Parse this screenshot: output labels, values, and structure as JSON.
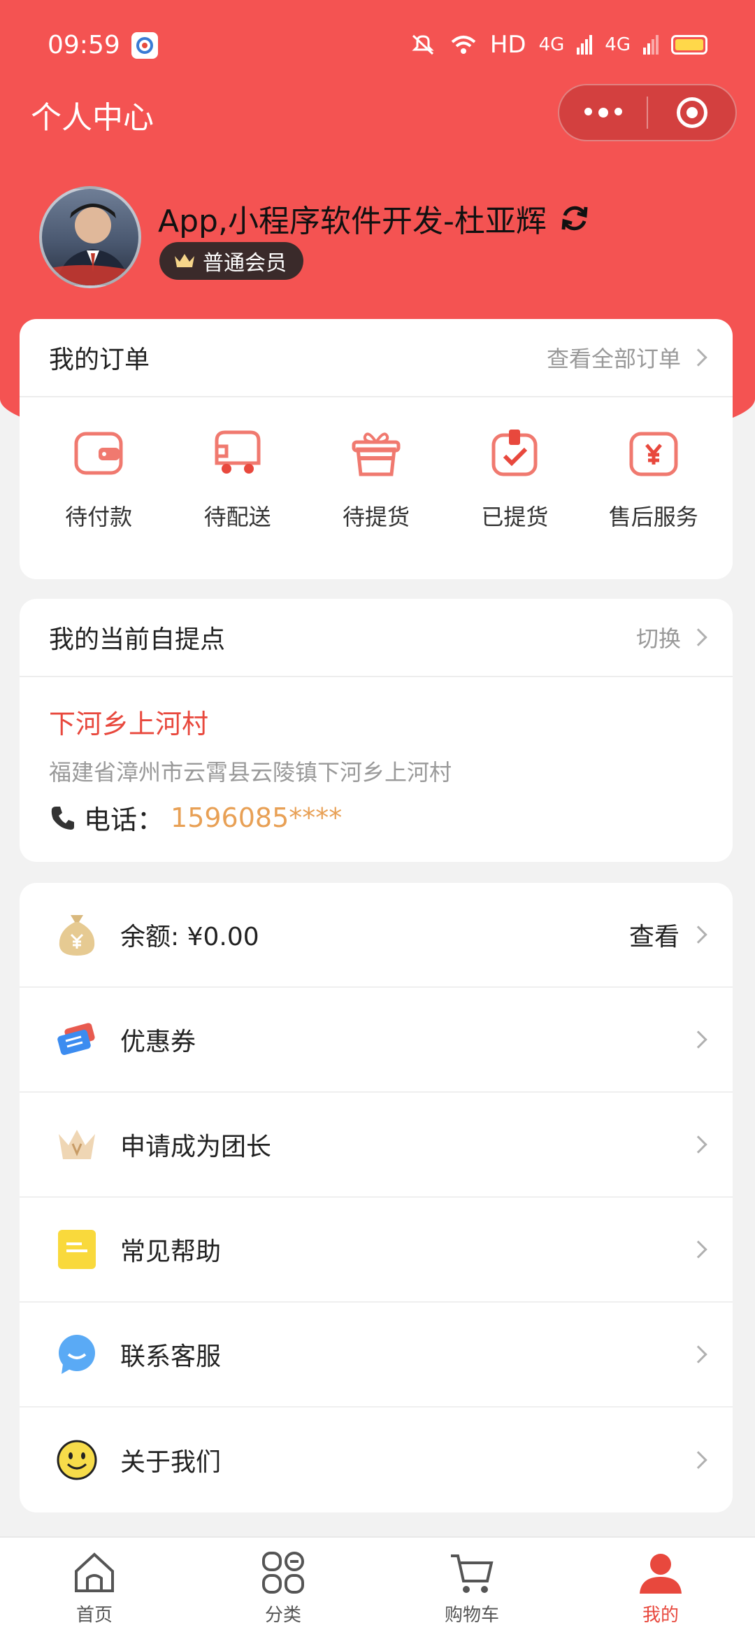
{
  "status_bar": {
    "time": "09:59",
    "network": "HD",
    "signal1": "4G",
    "signal2": "4G"
  },
  "nav": {
    "title": "个人中心"
  },
  "user": {
    "name": "App,小程序软件开发-杜亚辉",
    "member_level": "普通会员"
  },
  "orders": {
    "title": "我的订单",
    "view_all": "查看全部订单",
    "items": [
      {
        "label": "待付款",
        "icon": "wallet-icon"
      },
      {
        "label": "待配送",
        "icon": "delivery-truck-icon"
      },
      {
        "label": "待提货",
        "icon": "gift-box-icon"
      },
      {
        "label": "已提货",
        "icon": "checked-box-icon"
      },
      {
        "label": "售后服务",
        "icon": "refund-yen-icon"
      }
    ]
  },
  "pickup": {
    "title": "我的当前自提点",
    "switch_label": "切换",
    "name": "下河乡上河村",
    "address": "福建省漳州市云霄县云陵镇下河乡上河村",
    "phone_label": "电话：",
    "phone": "1596085****"
  },
  "menu": [
    {
      "label": "余额: ¥0.00",
      "right": "查看",
      "icon": "money-bag-icon"
    },
    {
      "label": "优惠券",
      "right": "",
      "icon": "coupon-icon"
    },
    {
      "label": "申请成为团长",
      "right": "",
      "icon": "crown-icon"
    },
    {
      "label": "常见帮助",
      "right": "",
      "icon": "help-note-icon"
    },
    {
      "label": "联系客服",
      "right": "",
      "icon": "chat-bubble-icon"
    },
    {
      "label": "关于我们",
      "right": "",
      "icon": "smiley-icon"
    }
  ],
  "tabbar": [
    {
      "label": "首页",
      "icon": "home-icon",
      "active": false
    },
    {
      "label": "分类",
      "icon": "category-icon",
      "active": false
    },
    {
      "label": "购物车",
      "icon": "cart-icon",
      "active": false
    },
    {
      "label": "我的",
      "icon": "profile-icon",
      "active": true
    }
  ],
  "colors": {
    "brand_red": "#f45352",
    "accent_red": "#e8483d",
    "phone_orange": "#e8a055"
  }
}
